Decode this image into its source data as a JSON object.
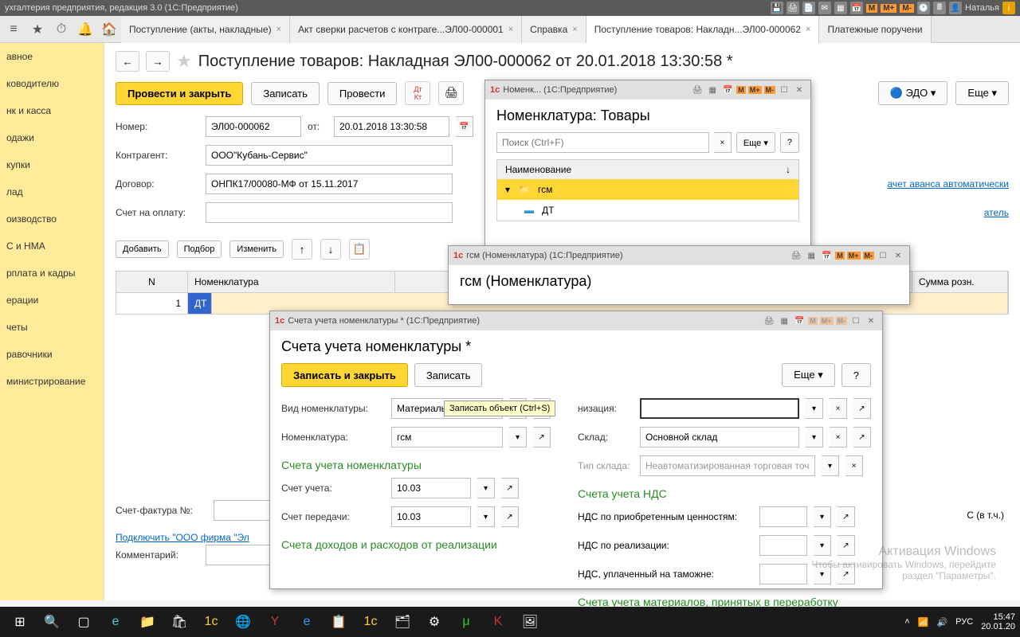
{
  "app": {
    "title": "ухгалтерия предприятия, редакция 3.0   (1С:Предприятие)",
    "user": "Наталья"
  },
  "topIcons": {
    "m": "M",
    "mp": "M+",
    "mm": "M-"
  },
  "tabs": [
    {
      "label": "Поступление (акты, накладные)"
    },
    {
      "label": "Акт сверки расчетов с контраге...ЭЛ00-000001"
    },
    {
      "label": "Справка"
    },
    {
      "label": "Поступление товаров: Накладн...ЭЛ00-000062",
      "active": true
    },
    {
      "label": "Платежные поручени"
    }
  ],
  "sidebar": {
    "items": [
      "авное",
      "ководителю",
      "нк и касса",
      "одажи",
      "купки",
      "лад",
      "оизводство",
      "С и НМА",
      "рплата и кадры",
      "ерации",
      "четы",
      "равочники",
      "министрирование"
    ]
  },
  "page": {
    "title": "Поступление товаров: Накладная ЭЛ00-000062 от 20.01.2018 13:30:58 *",
    "buttons": {
      "postClose": "Провести и закрыть",
      "save": "Записать",
      "post": "Провести",
      "edo": "ЭДО",
      "more": "Еще"
    },
    "form": {
      "numberLbl": "Номер:",
      "number": "ЭЛ00-000062",
      "dateLbl": "от:",
      "date": "20.01.2018 13:30:58",
      "contragentLbl": "Контрагент:",
      "contragent": "ООО\"Кубань-Сервис\"",
      "contractLbl": "Договор:",
      "contract": "ОНПК17/00080-МФ от 15.11.2017",
      "invoiceLbl": "Счет на оплату:",
      "link1": "ачет аванса автоматически",
      "link2": "атель"
    },
    "tableBtns": {
      "add": "Добавить",
      "pick": "Подбор",
      "edit": "Изменить"
    },
    "cols": {
      "n": "N",
      "nomk": "Номенклатура",
      "sumRetail": "Сумма розн."
    },
    "row": {
      "n": "1",
      "nomk": "ДТ"
    },
    "invoiceNumLbl": "Счет-фактура №:",
    "connectLink": "Подключить \"ООО фирма \"Эл",
    "commentLbl": "Комментарий:",
    "ndsSuffix": "С (в т.ч.)"
  },
  "dlgNomk": {
    "title": "Номенк...   (1С:Предприятие)",
    "heading": "Номенклатура: Товары",
    "searchPh": "Поиск (Ctrl+F)",
    "more": "Еще",
    "q": "?",
    "colName": "Наименование",
    "items": [
      {
        "icon": "folder",
        "label": "гсм",
        "sel": true
      },
      {
        "icon": "item",
        "label": "ДТ"
      }
    ]
  },
  "dlgGsm": {
    "title": "гсм (Номенклатура)  (1С:Предприятие)",
    "heading": "гсм (Номенклатура)"
  },
  "dlgAcc": {
    "title": "Счета учета номенклатуры *   (1С:Предприятие)",
    "heading": "Счета учета номенклатуры *",
    "btns": {
      "saveClose": "Записать и закрыть",
      "save": "Записать",
      "more": "Еще",
      "q": "?"
    },
    "tooltip": "Записать объект (Ctrl+S)",
    "labels": {
      "vidNomk": "Вид номенклатуры:",
      "vidNomkVal": "Материалы",
      "nomk": "Номенклатура:",
      "nomkVal": "гсм",
      "org": "низация:",
      "sklad": "Склад:",
      "skladVal": "Основной склад",
      "tipSklada": "Тип склада:",
      "tipSkladaVal": "Неавтоматизированная торговая точка"
    },
    "sections": {
      "s1": "Счета учета номенклатуры",
      "s2": "Счета учета НДС",
      "s3": "Счета доходов и расходов от реализации",
      "s4": "Счета учета материалов, принятых в переработку"
    },
    "acc": {
      "schetUchLbl": "Счет учета:",
      "schetUch": "10.03",
      "schetPerLbl": "Счет передачи:",
      "schetPer": "10.03",
      "ndsAcqLbl": "НДС по приобретенным ценностям:",
      "ndsRealLbl": "НДС по реализации:",
      "ndsCustLbl": "НДС, уплаченный на таможне:"
    }
  },
  "watermark": {
    "l1": "Активация Windows",
    "l2": "Чтобы активировать Windows, перейдите",
    "l3": "раздел \"Параметры\"."
  },
  "taskbar": {
    "lang": "РУС",
    "time": "15:47",
    "date": "20.01.20"
  }
}
